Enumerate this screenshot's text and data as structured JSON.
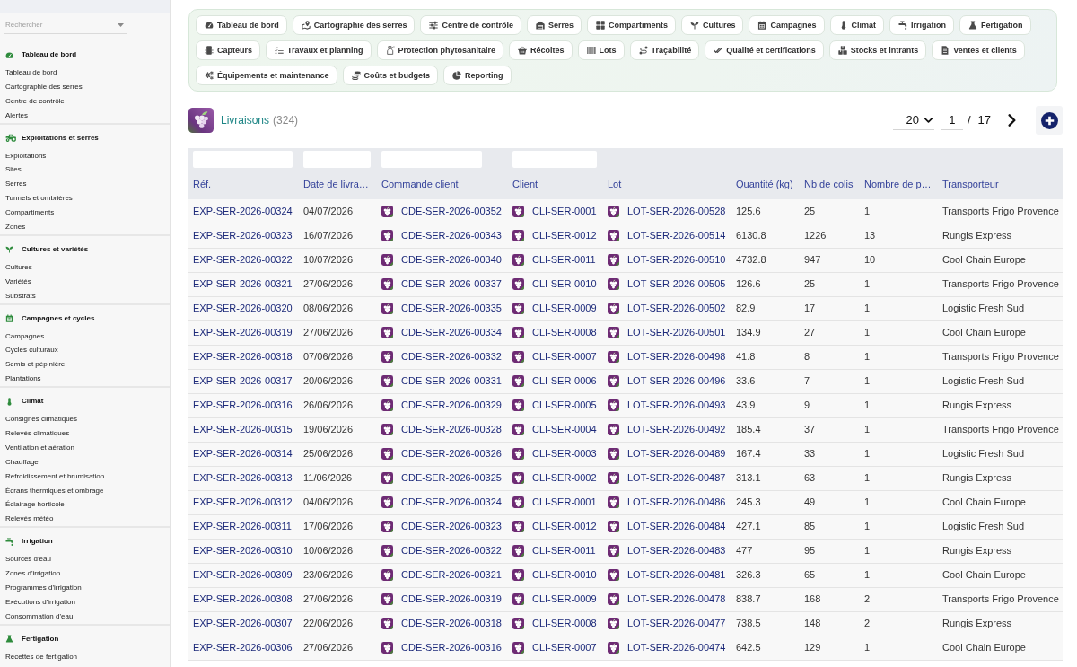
{
  "sidebar": {
    "search": {
      "placeholder": "Rechercher"
    },
    "sections": [
      {
        "title": "Tableau de bord",
        "items": [
          "Tableau de bord",
          "Cartographie des serres",
          "Centre de contrôle",
          "Alertes"
        ]
      },
      {
        "title": "Exploitations et serres",
        "items": [
          "Exploitations",
          "Sites",
          "Serres",
          "Tunnels et ombrières",
          "Compartiments",
          "Zones"
        ]
      },
      {
        "title": "Cultures et variétés",
        "items": [
          "Cultures",
          "Variétés",
          "Substrats"
        ]
      },
      {
        "title": "Campagnes et cycles",
        "items": [
          "Campagnes",
          "Cycles culturaux",
          "Semis et pépinière",
          "Plantations"
        ]
      },
      {
        "title": "Climat",
        "items": [
          "Consignes climatiques",
          "Relevés climatiques",
          "Ventilation et aération",
          "Chauffage",
          "Refroidissement et brumisation",
          "Écrans thermiques et ombrage",
          "Éclairage horticole",
          "Relevés météo"
        ]
      },
      {
        "title": "Irrigation",
        "items": [
          "Sources d'eau",
          "Zones d'irrigation",
          "Programmes d'irrigation",
          "Exécutions d'irrigation",
          "Consommation d'eau"
        ]
      },
      {
        "title": "Fertigation",
        "items": [
          "Recettes de fertigation"
        ]
      }
    ]
  },
  "nav_buttons": [
    "Tableau de bord",
    "Cartographie des serres",
    "Centre de contrôle",
    "Serres",
    "Compartiments",
    "Cultures",
    "Campagnes",
    "Climat",
    "Irrigation",
    "Fertigation",
    "Capteurs",
    "Travaux et planning",
    "Protection phytosanitaire",
    "Récoltes",
    "Lots",
    "Traçabilité",
    "Qualité et certifications",
    "Stocks et intrants",
    "Ventes et clients",
    "Équipements et maintenance",
    "Coûts et budgets",
    "Reporting"
  ],
  "page": {
    "title": "Livraisons",
    "count": "(324)",
    "page_size": "20",
    "page": "1",
    "page_separator": "/",
    "total_pages": "17"
  },
  "table": {
    "columns": [
      {
        "label": "Réf.",
        "kind": "link",
        "filter": true
      },
      {
        "label": "Date de livra…",
        "kind": "text",
        "filter": true
      },
      {
        "label": "Commande client",
        "kind": "badge_link",
        "filter": true
      },
      {
        "label": "Client",
        "kind": "badge_link",
        "filter": true
      },
      {
        "label": "Lot",
        "kind": "badge_link",
        "filter": false
      },
      {
        "label": "Quantité (kg)",
        "kind": "text",
        "filter": false
      },
      {
        "label": "Nb de colis",
        "kind": "text",
        "filter": false
      },
      {
        "label": "Nombre de p…",
        "kind": "text",
        "filter": false
      },
      {
        "label": "Transporteur",
        "kind": "text",
        "filter": false
      }
    ],
    "rows": [
      [
        "EXP-SER-2026-00324",
        "04/07/2026",
        "CDE-SER-2026-00352",
        "CLI-SER-0001",
        "LOT-SER-2026-00528",
        "125.6",
        "25",
        "1",
        "Transports Frigo Provence"
      ],
      [
        "EXP-SER-2026-00323",
        "16/07/2026",
        "CDE-SER-2026-00343",
        "CLI-SER-0012",
        "LOT-SER-2026-00514",
        "6130.8",
        "1226",
        "13",
        "Rungis Express"
      ],
      [
        "EXP-SER-2026-00322",
        "10/07/2026",
        "CDE-SER-2026-00340",
        "CLI-SER-0011",
        "LOT-SER-2026-00510",
        "4732.8",
        "947",
        "10",
        "Cool Chain Europe"
      ],
      [
        "EXP-SER-2026-00321",
        "27/06/2026",
        "CDE-SER-2026-00337",
        "CLI-SER-0010",
        "LOT-SER-2026-00505",
        "126.6",
        "25",
        "1",
        "Transports Frigo Provence"
      ],
      [
        "EXP-SER-2026-00320",
        "08/06/2026",
        "CDE-SER-2026-00335",
        "CLI-SER-0009",
        "LOT-SER-2026-00502",
        "82.9",
        "17",
        "1",
        "Logistic Fresh Sud"
      ],
      [
        "EXP-SER-2026-00319",
        "27/06/2026",
        "CDE-SER-2026-00334",
        "CLI-SER-0008",
        "LOT-SER-2026-00501",
        "134.9",
        "27",
        "1",
        "Cool Chain Europe"
      ],
      [
        "EXP-SER-2026-00318",
        "07/06/2026",
        "CDE-SER-2026-00332",
        "CLI-SER-0007",
        "LOT-SER-2026-00498",
        "41.8",
        "8",
        "1",
        "Transports Frigo Provence"
      ],
      [
        "EXP-SER-2026-00317",
        "20/06/2026",
        "CDE-SER-2026-00331",
        "CLI-SER-0006",
        "LOT-SER-2026-00496",
        "33.6",
        "7",
        "1",
        "Logistic Fresh Sud"
      ],
      [
        "EXP-SER-2026-00316",
        "26/06/2026",
        "CDE-SER-2026-00329",
        "CLI-SER-0005",
        "LOT-SER-2026-00493",
        "43.9",
        "9",
        "1",
        "Rungis Express"
      ],
      [
        "EXP-SER-2026-00315",
        "19/06/2026",
        "CDE-SER-2026-00328",
        "CLI-SER-0004",
        "LOT-SER-2026-00492",
        "185.4",
        "37",
        "1",
        "Transports Frigo Provence"
      ],
      [
        "EXP-SER-2026-00314",
        "25/06/2026",
        "CDE-SER-2026-00326",
        "CLI-SER-0003",
        "LOT-SER-2026-00489",
        "167.4",
        "33",
        "1",
        "Logistic Fresh Sud"
      ],
      [
        "EXP-SER-2026-00313",
        "11/06/2026",
        "CDE-SER-2026-00325",
        "CLI-SER-0002",
        "LOT-SER-2026-00487",
        "313.1",
        "63",
        "1",
        "Rungis Express"
      ],
      [
        "EXP-SER-2026-00312",
        "04/06/2026",
        "CDE-SER-2026-00324",
        "CLI-SER-0001",
        "LOT-SER-2026-00486",
        "245.3",
        "49",
        "1",
        "Cool Chain Europe"
      ],
      [
        "EXP-SER-2026-00311",
        "17/06/2026",
        "CDE-SER-2026-00323",
        "CLI-SER-0012",
        "LOT-SER-2026-00484",
        "427.1",
        "85",
        "1",
        "Logistic Fresh Sud"
      ],
      [
        "EXP-SER-2026-00310",
        "10/06/2026",
        "CDE-SER-2026-00322",
        "CLI-SER-0011",
        "LOT-SER-2026-00483",
        "477",
        "95",
        "1",
        "Rungis Express"
      ],
      [
        "EXP-SER-2026-00309",
        "23/06/2026",
        "CDE-SER-2026-00321",
        "CLI-SER-0010",
        "LOT-SER-2026-00481",
        "326.3",
        "65",
        "1",
        "Cool Chain Europe"
      ],
      [
        "EXP-SER-2026-00308",
        "27/06/2026",
        "CDE-SER-2026-00319",
        "CLI-SER-0009",
        "LOT-SER-2026-00478",
        "838.7",
        "168",
        "2",
        "Transports Frigo Provence"
      ],
      [
        "EXP-SER-2026-00307",
        "22/06/2026",
        "CDE-SER-2026-00318",
        "CLI-SER-0008",
        "LOT-SER-2026-00477",
        "738.5",
        "148",
        "2",
        "Rungis Express"
      ],
      [
        "EXP-SER-2026-00306",
        "27/06/2026",
        "CDE-SER-2026-00316",
        "CLI-SER-0007",
        "LOT-SER-2026-00474",
        "642.5",
        "129",
        "1",
        "Cool Chain Europe"
      ]
    ]
  }
}
